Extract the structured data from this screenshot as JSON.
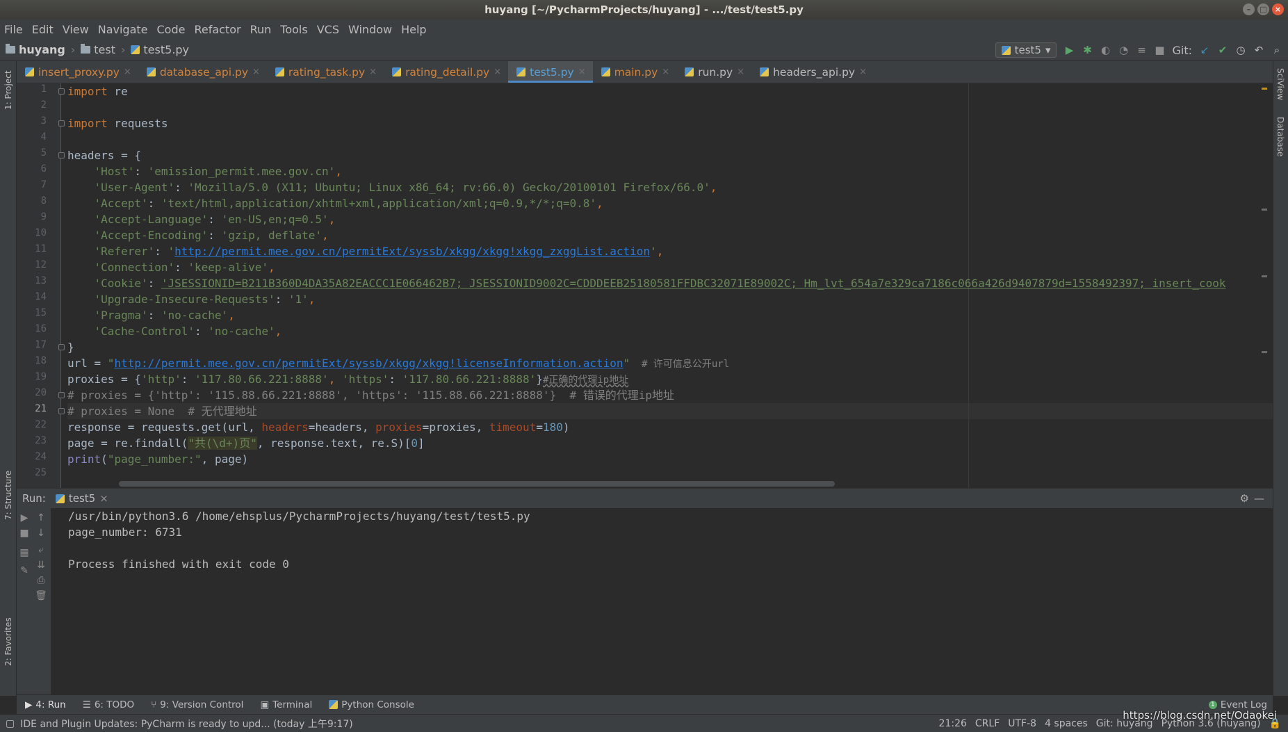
{
  "window": {
    "title": "huyang [~/PycharmProjects/huyang] - .../test/test5.py"
  },
  "menu": [
    "File",
    "Edit",
    "View",
    "Navigate",
    "Code",
    "Refactor",
    "Run",
    "Tools",
    "VCS",
    "Window",
    "Help"
  ],
  "breadcrumb": {
    "project": "huyang",
    "folder": "test",
    "file": "test5.py"
  },
  "toolbar": {
    "run_config": "test5",
    "git_label": "Git:"
  },
  "left_strip": {
    "project": "1: Project",
    "structure": "7: Structure",
    "favorites": "2: Favorites"
  },
  "right_strip": {
    "sciview": "SciView",
    "database": "Database"
  },
  "tabs": [
    {
      "label": "insert_proxy.py"
    },
    {
      "label": "database_api.py"
    },
    {
      "label": "rating_task.py"
    },
    {
      "label": "rating_detail.py"
    },
    {
      "label": "test5.py"
    },
    {
      "label": "main.py"
    },
    {
      "label": "run.py"
    },
    {
      "label": "headers_api.py"
    }
  ],
  "editor": {
    "line_numbers": [
      "1",
      "2",
      "3",
      "4",
      "5",
      "6",
      "7",
      "8",
      "9",
      "10",
      "11",
      "12",
      "13",
      "14",
      "15",
      "16",
      "17",
      "18",
      "19",
      "20",
      "21",
      "22",
      "23",
      "24",
      "25"
    ],
    "current_line": "21",
    "code": {
      "l1_kw": "import",
      "l1_rest": " re",
      "l3_kw": "import",
      "l3_rest": " requests",
      "l5": "headers = {",
      "l6_key": "'Host'",
      "l6_val": "'emission_permit.mee.gov.cn'",
      "l7_key": "'User-Agent'",
      "l7_val": "'Mozilla/5.0 (X11; Ubuntu; Linux x86_64; rv:66.0) Gecko/20100101 Firefox/66.0'",
      "l8_key": "'Accept'",
      "l8_val": "'text/html,application/xhtml+xml,application/xml;q=0.9,*/*;q=0.8'",
      "l9_key": "'Accept-Language'",
      "l9_val": "'en-US,en;q=0.5'",
      "l10_key": "'Accept-Encoding'",
      "l10_val": "'gzip, deflate'",
      "l11_key": "'Referer'",
      "l11_q": "'",
      "l11_url": "http://permit.mee.gov.cn/permitExt/syssb/xkgg/xkgg!xkgg_zxggList.action",
      "l12_key": "'Connection'",
      "l12_val": "'keep-alive'",
      "l13_key": "'Cookie'",
      "l13_val": "'JSESSIONID=B211B360D4DA35A82EACCC1E066462B7; JSESSIONID9002C=CDDDEEB25180581FFDBC32071E89002C; Hm_lvt_654a7e329ca7186c066a426d9407879d=1558492397; insert_cook",
      "l14_key": "'Upgrade-Insecure-Requests'",
      "l14_val": "'1'",
      "l15_key": "'Pragma'",
      "l15_val": "'no-cache'",
      "l16_key": "'Cache-Control'",
      "l16_val": "'no-cache'",
      "l17": "}",
      "l18_a": "url = ",
      "l18_q": "\"",
      "l18_url": "http://permit.mee.gov.cn/permitExt/syssb/xkgg/xkgg!licenseInformation.action",
      "l18_cm": "  # 许可信息公开url",
      "l19_a": "proxies = {",
      "l19_k1": "'http'",
      "l19_v1": "'117.80.66.221:8888'",
      "l19_k2": "'https'",
      "l19_v2": "'117.80.66.221:8888'",
      "l19_b": "}",
      "l19_cm": "#正确的代理ip地址",
      "l20": "# proxies = {'http': '115.88.66.221:8888', 'https': '115.88.66.221:8888'}  # 错误的代理ip地址",
      "l21": "# proxies = None  # 无代理地址",
      "l22_a": "response = requests.get(url, ",
      "l22_p1": "headers",
      "l22_b": "=headers, ",
      "l22_p2": "proxies",
      "l22_c": "=proxies, ",
      "l22_p3": "timeout",
      "l22_num": "180",
      "l23_a": "page = re.findall(",
      "l23_str": "\"共(\\d+)页\"",
      "l23_b": ", response.text, re.S)[",
      "l23_num": "0",
      "l23_c": "]",
      "l24_fn": "print",
      "l24_a": "(",
      "l24_str": "\"page_number:\"",
      "l24_b": ", page)"
    }
  },
  "run": {
    "label": "Run:",
    "tab": "test5",
    "output": [
      "/usr/bin/python3.6 /home/ehsplus/PycharmProjects/huyang/test/test5.py",
      "page_number: 6731",
      "",
      "Process finished with exit code 0"
    ]
  },
  "tool_tabs": [
    {
      "label": "4: Run"
    },
    {
      "label": "6: TODO"
    },
    {
      "label": "9: Version Control"
    },
    {
      "label": "Terminal"
    },
    {
      "label": "Python Console"
    }
  ],
  "event_log": "Event Log",
  "status": {
    "message": "IDE and Plugin Updates: PyCharm is ready to upd... (today 上午9:17)",
    "position": "21:26",
    "line_sep": "CRLF",
    "encoding": "UTF-8",
    "indent": "4 spaces",
    "git": "Git: huyang",
    "interpreter": "Python 3.6 (huyang)"
  },
  "watermark": "https://blog.csdn.net/Odaokei"
}
